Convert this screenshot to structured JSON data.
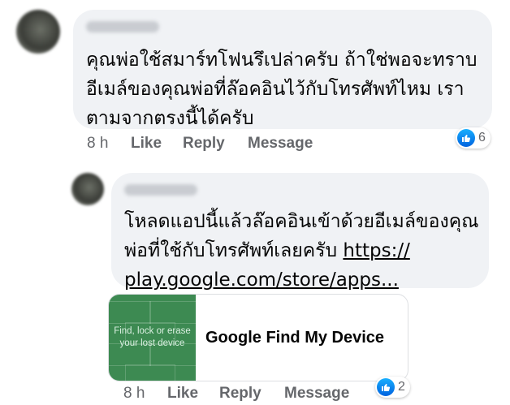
{
  "comments": [
    {
      "text_line1": "คุณพ่อใช้สมาร์ทโฟนรึเปล่าครับ ถ้าใช่พอจะทราบ",
      "text_line2": "อีเมล์ของคุณพ่อที่ล๊อคอินไว้กับโทรศัพท์ไหม เรา",
      "text_line3": "ตามจากตรงนี้ได้ครับ",
      "time": "8 h",
      "like_label": "Like",
      "reply_label": "Reply",
      "message_label": "Message",
      "reaction_count": "6"
    },
    {
      "text_line1": "โหลดแอปนี้แล้วล๊อคอินเข้าด้วยอีเมล์ของคุณ",
      "text_line2_prefix": "พ่อที่ใช้กับโทรศัพท์เลยครับ ",
      "link_part1": "https://",
      "link_part2": "play.google.com/store/apps...",
      "card": {
        "image_text_line1": "Find, lock or erase",
        "image_text_line2": "your lost device",
        "title": "Google Find My Device"
      },
      "time": "8 h",
      "like_label": "Like",
      "reply_label": "Reply",
      "message_label": "Message",
      "reaction_count": "2"
    }
  ],
  "colors": {
    "bubble_bg": "#f0f2f5",
    "action_text": "#65676b",
    "like_blue": "#1877f2",
    "card_green": "#3d8a52"
  },
  "icons": [
    "avatar",
    "like-reaction-icon"
  ]
}
